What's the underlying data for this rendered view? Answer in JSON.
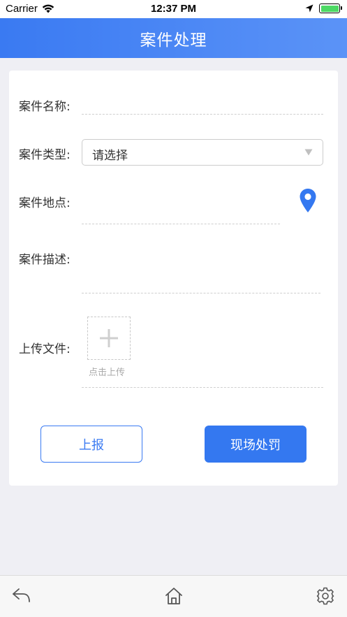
{
  "status_bar": {
    "carrier": "Carrier",
    "time": "12:37 PM",
    "battery_level": 1.0
  },
  "nav": {
    "title": "案件处理"
  },
  "form": {
    "case_name_label": "案件名称:",
    "case_type_label": "案件类型:",
    "case_type_value": "请选择",
    "case_location_label": "案件地点:",
    "case_description_label": "案件描述:",
    "upload_label": "上传文件:",
    "upload_hint": "点击上传"
  },
  "actions": {
    "report_label": "上报",
    "penalty_label": "现场处罚"
  },
  "tab_bar": {
    "items": [
      "back-icon",
      "home-icon",
      "settings-icon"
    ]
  },
  "colors": {
    "accent": "#3478f0",
    "nav_gradient_start": "#3a7af2",
    "nav_gradient_end": "#5b93f7",
    "battery": "#4cd964"
  },
  "icons": {
    "signal": "wifi-icon",
    "location_status": "location-arrow-icon",
    "location_picker": "map-pin-icon",
    "dropdown": "triangle-down-icon",
    "upload": "plus-icon"
  }
}
